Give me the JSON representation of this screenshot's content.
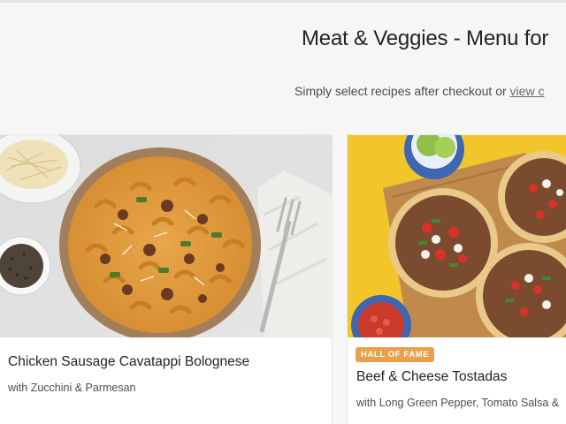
{
  "header": {
    "title": "Meat & Veggies - Menu for",
    "subtitle_text": "Simply select recipes after checkout or ",
    "subtitle_link": "view c"
  },
  "recipes": [
    {
      "name": "Chicken Sausage Cavatappi Bolognese",
      "subtitle": "with Zucchini & Parmesan",
      "badge": ""
    },
    {
      "name": "Beef & Cheese Tostadas",
      "subtitle": "with Long Green Pepper, Tomato Salsa &",
      "badge": "HALL OF FAME"
    }
  ],
  "colors": {
    "background": "#f6f6f6",
    "badge": "#e8a04c",
    "card": "#ffffff",
    "tostada_backdrop": "#f2c62b"
  }
}
